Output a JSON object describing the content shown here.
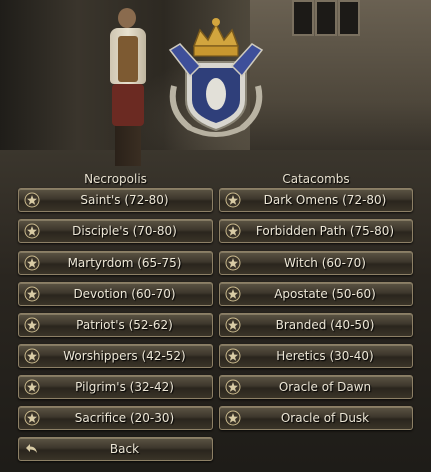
{
  "columns": {
    "left_title": "Necropolis",
    "right_title": "Catacombs"
  },
  "necropolis": [
    {
      "label": "Saint's (72-80)"
    },
    {
      "label": "Disciple's (70-80)"
    },
    {
      "label": "Martyrdom (65-75)"
    },
    {
      "label": "Devotion (60-70)"
    },
    {
      "label": "Patriot's (52-62)"
    },
    {
      "label": "Worshippers (42-52)"
    },
    {
      "label": "Pilgrim's (32-42)"
    },
    {
      "label": "Sacrifice (20-30)"
    }
  ],
  "catacombs": [
    {
      "label": "Dark Omens (72-80)"
    },
    {
      "label": "Forbidden Path (75-80)"
    },
    {
      "label": "Witch (60-70)"
    },
    {
      "label": "Apostate (50-60)"
    },
    {
      "label": "Branded (40-50)"
    },
    {
      "label": "Heretics (30-40)"
    },
    {
      "label": "Oracle of Dawn"
    },
    {
      "label": "Oracle of Dusk"
    }
  ],
  "footer": {
    "back_label": "Back"
  },
  "icons": {
    "teleport": "teleport-emblem-icon",
    "back": "back-arrow-icon"
  },
  "colors": {
    "button_text": "#ece6d6",
    "button_border": "#8d8066"
  }
}
